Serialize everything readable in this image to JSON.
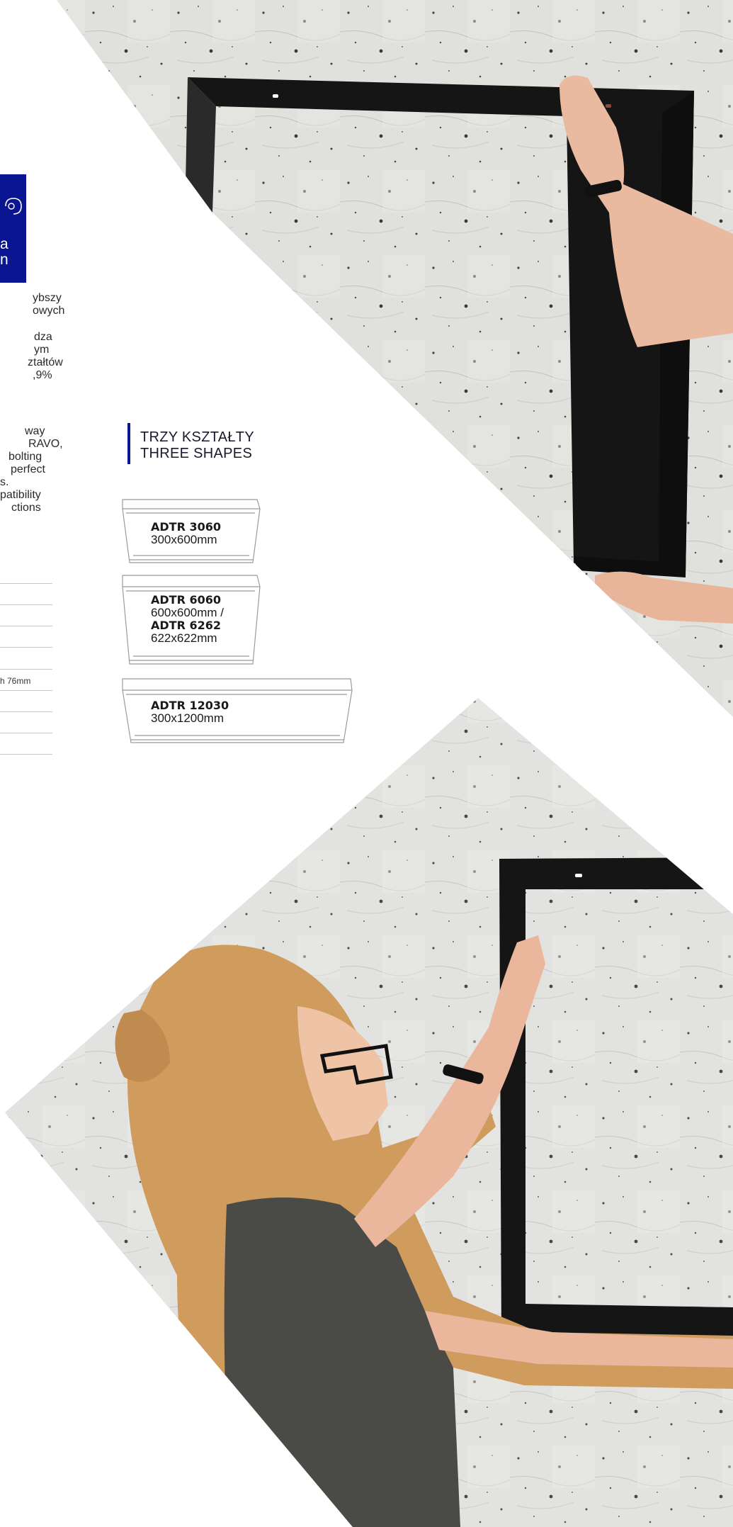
{
  "left_column": {
    "card_lines": [
      "a",
      "n"
    ],
    "pl_fragments": [
      "ybszy",
      "owych",
      "dza",
      "ym",
      "ztałtów",
      ",9%"
    ],
    "en_fragments": [
      "way",
      "RAVO,",
      "bolting",
      "perfect",
      "s.",
      "patibility",
      "ctions"
    ],
    "table_row_text": "h 76mm"
  },
  "shapes": {
    "title_pl": "TRZY KSZTAŁTY",
    "title_en": "THREE SHAPES",
    "items": [
      {
        "code": "ADTR 3060",
        "dim": "300x600mm"
      },
      {
        "code": "ADTR 6060",
        "dim": "600x600mm /",
        "code2": "ADTR 6262",
        "dim2": "622x622mm"
      },
      {
        "code": "ADTR 12030",
        "dim": "300x1200mm"
      }
    ]
  },
  "colors": {
    "brand_blue": "#0a1591",
    "frame_black": "#151515",
    "wall": "#d9d9d6"
  }
}
